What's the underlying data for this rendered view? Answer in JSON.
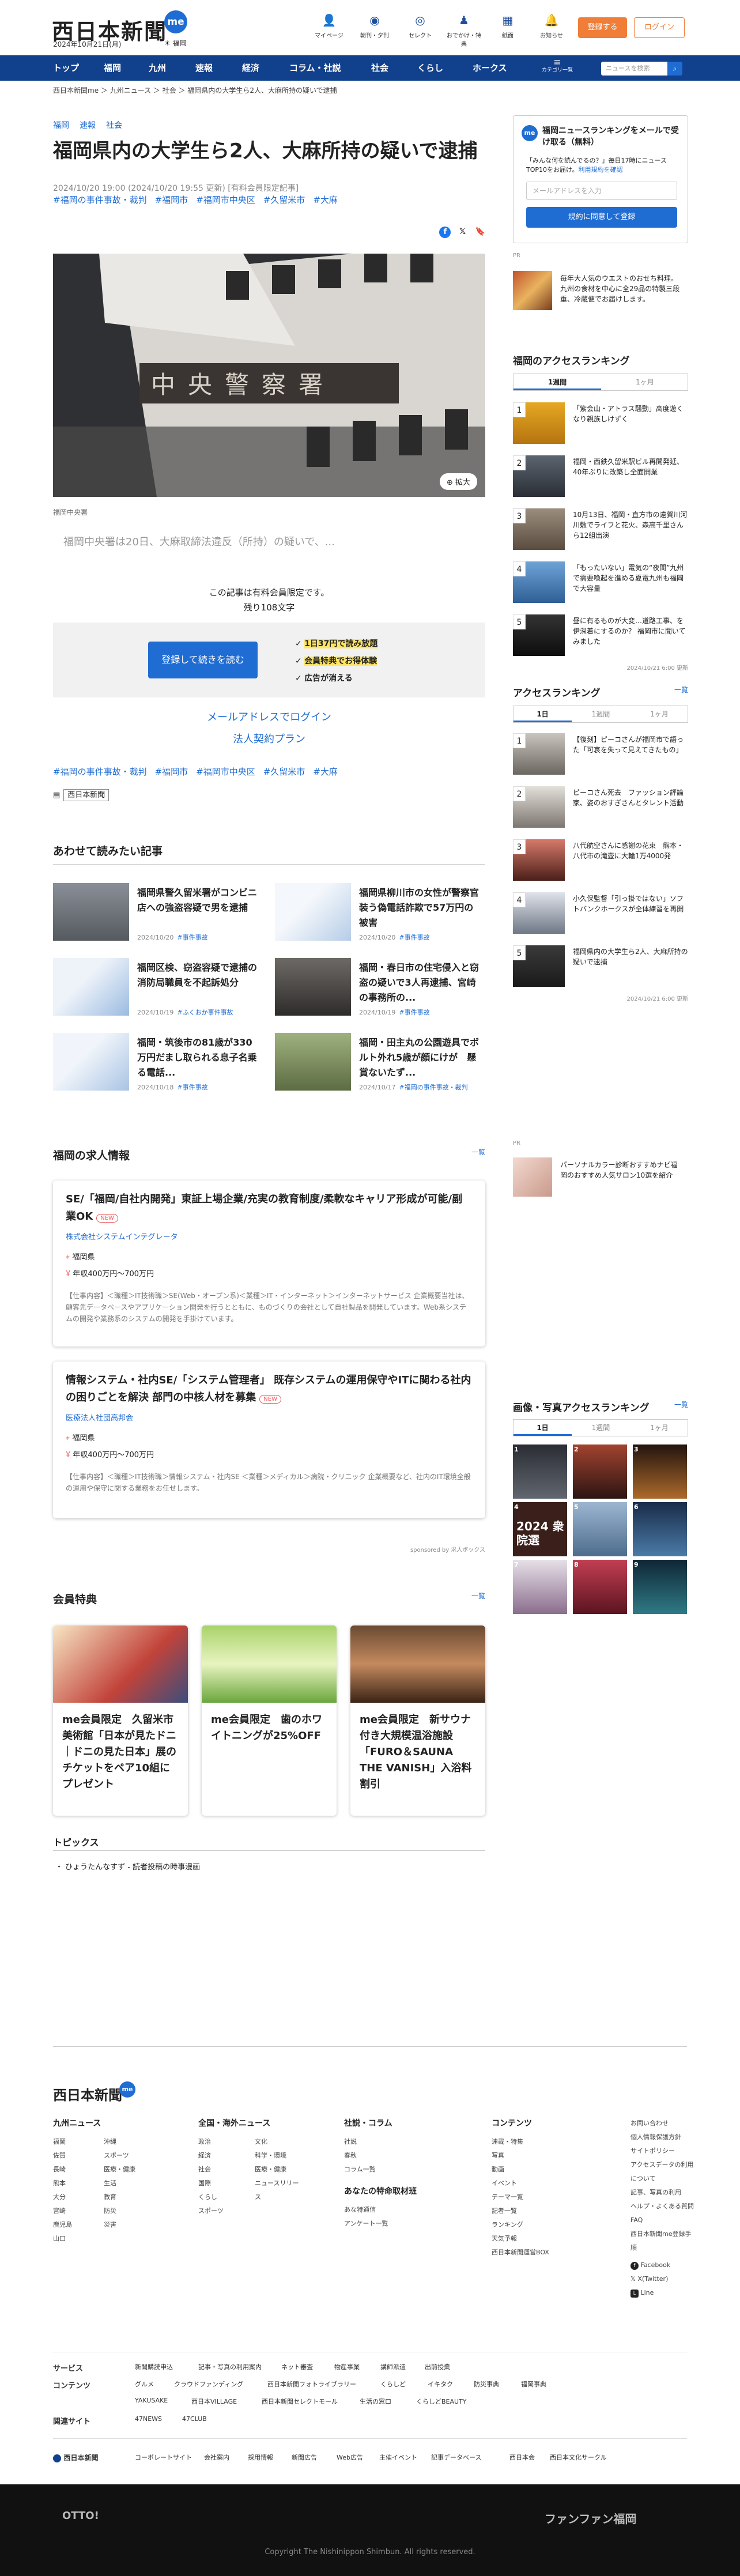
{
  "header": {
    "logo": "西日本新聞",
    "me": "me",
    "date": "2024年10月21日(月)",
    "weather": "☀ 福岡",
    "icons": [
      {
        "label": "マイページ",
        "icon": "person-icon"
      },
      {
        "label": "朝刊・夕刊",
        "icon": "newspaper-icon"
      },
      {
        "label": "セレクト",
        "icon": "select-icon"
      },
      {
        "label": "おでかけ・特典",
        "icon": "ticket-icon"
      },
      {
        "label": "紙面",
        "icon": "paper-icon"
      },
      {
        "label": "お知らせ",
        "icon": "bell-icon"
      }
    ],
    "register": "登録する",
    "login": "ログイン"
  },
  "nav": {
    "items": [
      "トップ",
      "福岡",
      "九州",
      "速報",
      "経済",
      "コラム・社説",
      "社会",
      "くらし",
      "ホークス"
    ],
    "category": "カテゴリ一覧",
    "search_placeholder": "ニュースを検索"
  },
  "breadcrumb": "西日本新聞me ＞ 九州ニュース ＞ 社会 ＞ 福岡県内の大学生ら2人、大麻所持の疑いで逮捕",
  "article": {
    "cats": [
      "福岡",
      "速報",
      "社会"
    ],
    "title": "福岡県内の大学生ら2人、大麻所持の疑いで逮捕",
    "meta": "2024/10/20 19:00 (2024/10/20 19:55 更新) [有料会員限定記事]",
    "tags": [
      "#福岡の事件事故・裁判",
      "#福岡市",
      "#福岡市中央区",
      "#久留米市",
      "#大麻"
    ],
    "photo_sign": "中央警察署",
    "expand": "⊕ 拡大",
    "caption": "福岡中央署",
    "lead": "福岡中央署は20日、大麻取締法違反（所持）の疑いで、...",
    "paywall": "この記事は有料会員限定です。",
    "remaining": "残り108文字",
    "pay_button": "登録して続きを読む",
    "perks": [
      {
        "pre": "✓ ",
        "hl": "1日37円で読み放題"
      },
      {
        "pre": "✓ ",
        "hl": "会員特典でお得体験"
      },
      {
        "pre": "✓ ",
        "hl": "広告が消える"
      }
    ],
    "mail_login": "メールアドレスでログイン",
    "corp_plan": "法人契約プラン",
    "source_label": "西日本新聞"
  },
  "related": {
    "title": "あわせて読みたい記事",
    "items": [
      {
        "title": "福岡県警久留米署がコンビニ店への強盗容疑で男を逮捕",
        "date": "2024/10/20",
        "cat": "#事件事故"
      },
      {
        "title": "福岡県柳川市の女性が警察官装う偽電話詐欺で57万円の被害",
        "date": "2024/10/20",
        "cat": "#事件事故"
      },
      {
        "title": "福岡区検、窃盗容疑で逮捕の消防局職員を不起訴処分",
        "date": "2024/10/19",
        "cat": "#ふくおか事件事故"
      },
      {
        "title": "福岡・春日市の住宅侵入と窃盗の疑いで3人再逮捕、宮崎の事務所の...",
        "date": "2024/10/19",
        "cat": "#事件事故"
      },
      {
        "title": "福岡・筑後市の81歳が330万円だまし取られる息子名乗る電話...",
        "date": "2024/10/18",
        "cat": "#事件事故"
      },
      {
        "title": "福岡・田主丸の公園遊具でボルト外れ5歳が顔にけが　懸賞ないたず...",
        "date": "2024/10/17",
        "cat": "#福岡の事件事故・裁判"
      }
    ]
  },
  "jobs": {
    "title": "福岡の求人情報",
    "more": "一覧",
    "items": [
      {
        "title": "SE/「福岡/自社内開発」東証上場企業/充実の教育制度/柔軟なキャリア形成が可能/副業OK",
        "new": "NEW",
        "company": "株式会社システムインテグレータ",
        "loc": "福岡県",
        "salary": "年収400万円〜700万円",
        "desc": "【仕事内容】＜職種＞IT技術職＞SE(Web・オープン系)＜業種＞IT・インターネット＞インターネットサービス 企業概要当社は、顧客先データベースやアプリケーション開発を行うとともに、ものづくりの会社として自社製品を開発しています。Web系システムの開発や業務系のシステムの開発を手掛けています。"
      },
      {
        "title": "情報システム・社内SE/「システム管理者」 既存システムの運用保守やITに関わる社内の困りごとを解決 部門の中核人材を募集",
        "new": "NEW",
        "company": "医療法人社団高邦会",
        "loc": "福岡県",
        "salary": "年収400万円〜700万円",
        "desc": "【仕事内容】＜職種＞IT技術職＞情報システム・社内SE ＜業種＞メディカル＞病院・クリニック 企業概要など、社内のIT環境全般の運用や保守に関する業務をお任せします。"
      }
    ],
    "sponsor": "sponsored by 求人ボックス"
  },
  "perks_sec": {
    "title": "会員特典",
    "more": "一覧",
    "items": [
      {
        "title": "me会員限定　久留米市美術館「日本が見たドニ｜ドニの見た日本」展のチケットをペア10組にプレゼント"
      },
      {
        "title": "me会員限定　歯のホワイトニングが25%OFF"
      },
      {
        "title": "me会員限定　新サウナ付き大規模温浴施設「FURO＆SAUNA THE VANISH」入浴料割引"
      }
    ]
  },
  "topics": {
    "title": "トピックス",
    "item": "・ ひょうたんなすず - 読者投稿の時事漫画"
  },
  "side": {
    "mail": {
      "title": "福岡ニュースランキングをメールで受け取る（無料）",
      "sub": "「みんな何を読んでるの？」毎日17時にニュースTOP10をお届け。",
      "link": "利用規約を確認",
      "placeholder": "メールアドレスを入力",
      "button": "規約に同意して登録"
    },
    "ad_label": "PR",
    "ad1": "毎年大人気のウエストのおせち料理。九州の食材を中心に全29品の特製三段重、冷蔵便でお届けします。",
    "access": {
      "title": "福岡のアクセスランキング",
      "tabs": [
        "1週間",
        "1ヶ月"
      ],
      "items": [
        "「紫会山・アトラス騒動」高度遊くなり親族しけずく",
        "福岡・西鉄久留米駅ビル再開発延、40年ぶりに改築し全面開業",
        "10月13日、福岡・直方市の遠賀川河川敷でライフと花火、森高千里さんら12組出演",
        "「もったいない」電気の“夜間”九州で需要喚起を進める夏電九州も福岡で大容量",
        "昼に有るものが大変…道路工事、を伊深着にするのか？ 福岡市に聞いてみました"
      ],
      "updated": "2024/10/21 6:00 更新"
    },
    "access2": {
      "title": "アクセスランキング",
      "more": "一覧",
      "tabs": [
        "1日",
        "1週間",
        "1ヶ月"
      ],
      "items": [
        "【復刻】ピーコさんが福岡市で語った「可哀を失って見えてきたもの」",
        "ピーコさん死去　ファッション評論家、姿のおすぎさんとタレント活動",
        "八代航空さんに感謝の花束　熊本・八代市の滝壺に大輪1万4000発",
        "小久保監督「引っ掛ではない」ソフトバンクホークスが全体練習を再開",
        "福岡県内の大学生ら2人、大麻所持の疑いで逮捕"
      ],
      "updated": "2024/10/21 6:00 更新"
    },
    "ad2": "パーソナルカラー診断おすすめナビ福岡のおすすめ人気サロン10選を紹介",
    "gallery": {
      "title": "画像・写真アクセスランキング",
      "more": "一覧",
      "tabs": [
        "1日",
        "1週間",
        "1ヶ月"
      ],
      "nums": [
        "1",
        "2",
        "3",
        "4",
        "5",
        "6",
        "7",
        "8",
        "9"
      ],
      "big": "2024 衆院選"
    }
  },
  "footer": {
    "logo": "西日本新聞",
    "me": "me",
    "cols": [
      {
        "title": "九州ニュース",
        "items": [
          "福岡",
          "佐賀",
          "長崎",
          "熊本",
          "大分",
          "宮崎",
          "鹿児島",
          "山口",
          "沖縄",
          "スポーツ",
          "医療・健康",
          "生活",
          "教育",
          "防災",
          "災害"
        ]
      },
      {
        "title": "全国・海外ニュース",
        "items": [
          "政治",
          "経済",
          "社会",
          "国際",
          "くらし",
          "スポーツ",
          "文化",
          "科学・環境",
          "医療・健康",
          "ニュースリリース"
        ]
      },
      {
        "title": "社説・コラム",
        "items": [
          "社説",
          "春秋",
          "コラム一覧"
        ]
      },
      {
        "title": "あなたの特命取材班",
        "items": [
          "あな特通信",
          "アンケート一覧"
        ]
      },
      {
        "title": "コンテンツ",
        "items": [
          "連載・特集",
          "写真",
          "動画",
          "イベント",
          "テーマ一覧",
          "記者一覧",
          "ランキング",
          "天気予報",
          "西日本新聞運営BOX"
        ]
      }
    ],
    "small": [
      "お問い合わせ",
      "個人情報保護方針",
      "サイトポリシー",
      "アクセスデータの利用について",
      "記事、写真の利用",
      "ヘルプ・よくある質問",
      "FAQ",
      "西日本新聞me登録手順",
      "Facebook",
      "X(Twitter)",
      "Line"
    ],
    "service": {
      "label": "サービス",
      "items": [
        "新聞購読申込",
        "記事・写真の利用案内",
        "ネット審査",
        "物産事業",
        "講師派遣",
        "出前授業"
      ]
    },
    "content": {
      "label": "コンテンツ",
      "items": [
        "グルメ",
        "クラウドファンディング",
        "西日本新聞フォトライブラリー",
        "くらしど",
        "イキタク",
        "防災事典",
        "福岡事典",
        "YAKUSAKE",
        "西日本VILLAGE",
        "西日本新聞セレクトモール",
        "生活の窓口",
        "くらしどBEAUTY"
      ]
    },
    "sister": {
      "label": "関連サイト",
      "items": [
        "47NEWS",
        "47CLUB"
      ]
    },
    "company": {
      "logo": "西日本新聞",
      "items": [
        "コーポレートサイト",
        "会社案内",
        "採用情報",
        "新聞広告",
        "Web広告",
        "主催イベント",
        "記事データベース",
        "西日本会",
        "西日本文化サークル"
      ]
    },
    "otto": "OTTO!",
    "fanfun": "ファンファン福岡",
    "copyright": "Copyright The Nishinippon Shimbun. All rights reserved."
  }
}
